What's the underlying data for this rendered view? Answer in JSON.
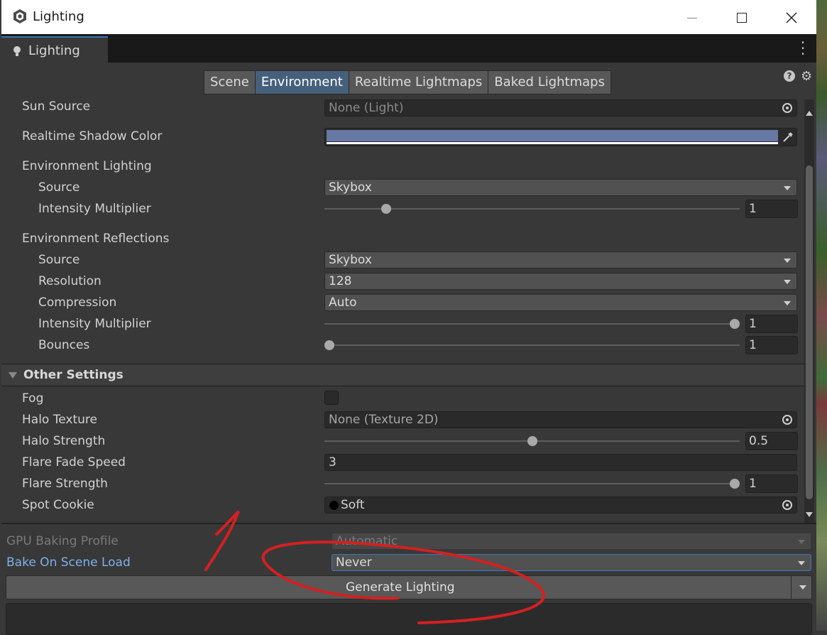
{
  "window": {
    "title": "Lighting",
    "minimize_icon": "minimize-icon",
    "maximize_icon": "maximize-icon",
    "close_icon": "close-icon"
  },
  "tab": {
    "label": "Lighting",
    "icon": "lightbulb-icon"
  },
  "subtabs": [
    "Scene",
    "Environment",
    "Realtime Lightmaps",
    "Baked Lightmaps"
  ],
  "active_subtab": "Environment",
  "environment": {
    "sun_source": {
      "label": "Sun Source",
      "value": "None (Light)"
    },
    "realtime_shadow_color": {
      "label": "Realtime Shadow Color",
      "color": "#6878a4"
    },
    "env_lighting": {
      "heading": "Environment Lighting",
      "source_label": "Source",
      "source_value": "Skybox",
      "intensity_label": "Intensity Multiplier",
      "intensity_value": "1",
      "intensity_fraction": 0.14
    },
    "env_reflections": {
      "heading": "Environment Reflections",
      "source_label": "Source",
      "source_value": "Skybox",
      "resolution_label": "Resolution",
      "resolution_value": "128",
      "compression_label": "Compression",
      "compression_value": "Auto",
      "intensity_label": "Intensity Multiplier",
      "intensity_value": "1",
      "intensity_fraction": 1.0,
      "bounces_label": "Bounces",
      "bounces_value": "1",
      "bounces_fraction": 0.0
    }
  },
  "other_settings": {
    "heading": "Other Settings",
    "fog_label": "Fog",
    "fog_checked": false,
    "halo_texture_label": "Halo Texture",
    "halo_texture_value": "None (Texture 2D)",
    "halo_strength_label": "Halo Strength",
    "halo_strength_value": "0.5",
    "halo_strength_fraction": 0.5,
    "flare_fade_label": "Flare Fade Speed",
    "flare_fade_value": "3",
    "flare_strength_label": "Flare Strength",
    "flare_strength_value": "1",
    "flare_strength_fraction": 1.0,
    "spot_cookie_label": "Spot Cookie",
    "spot_cookie_value": "Soft"
  },
  "bottom": {
    "gpu_profile_label": "GPU Baking Profile",
    "gpu_profile_value": "Automatic",
    "bake_on_load_label": "Bake On Scene Load",
    "bake_on_load_value": "Never",
    "generate_label": "Generate Lighting"
  },
  "annotation": {
    "number": "1",
    "color": "#d42020"
  }
}
